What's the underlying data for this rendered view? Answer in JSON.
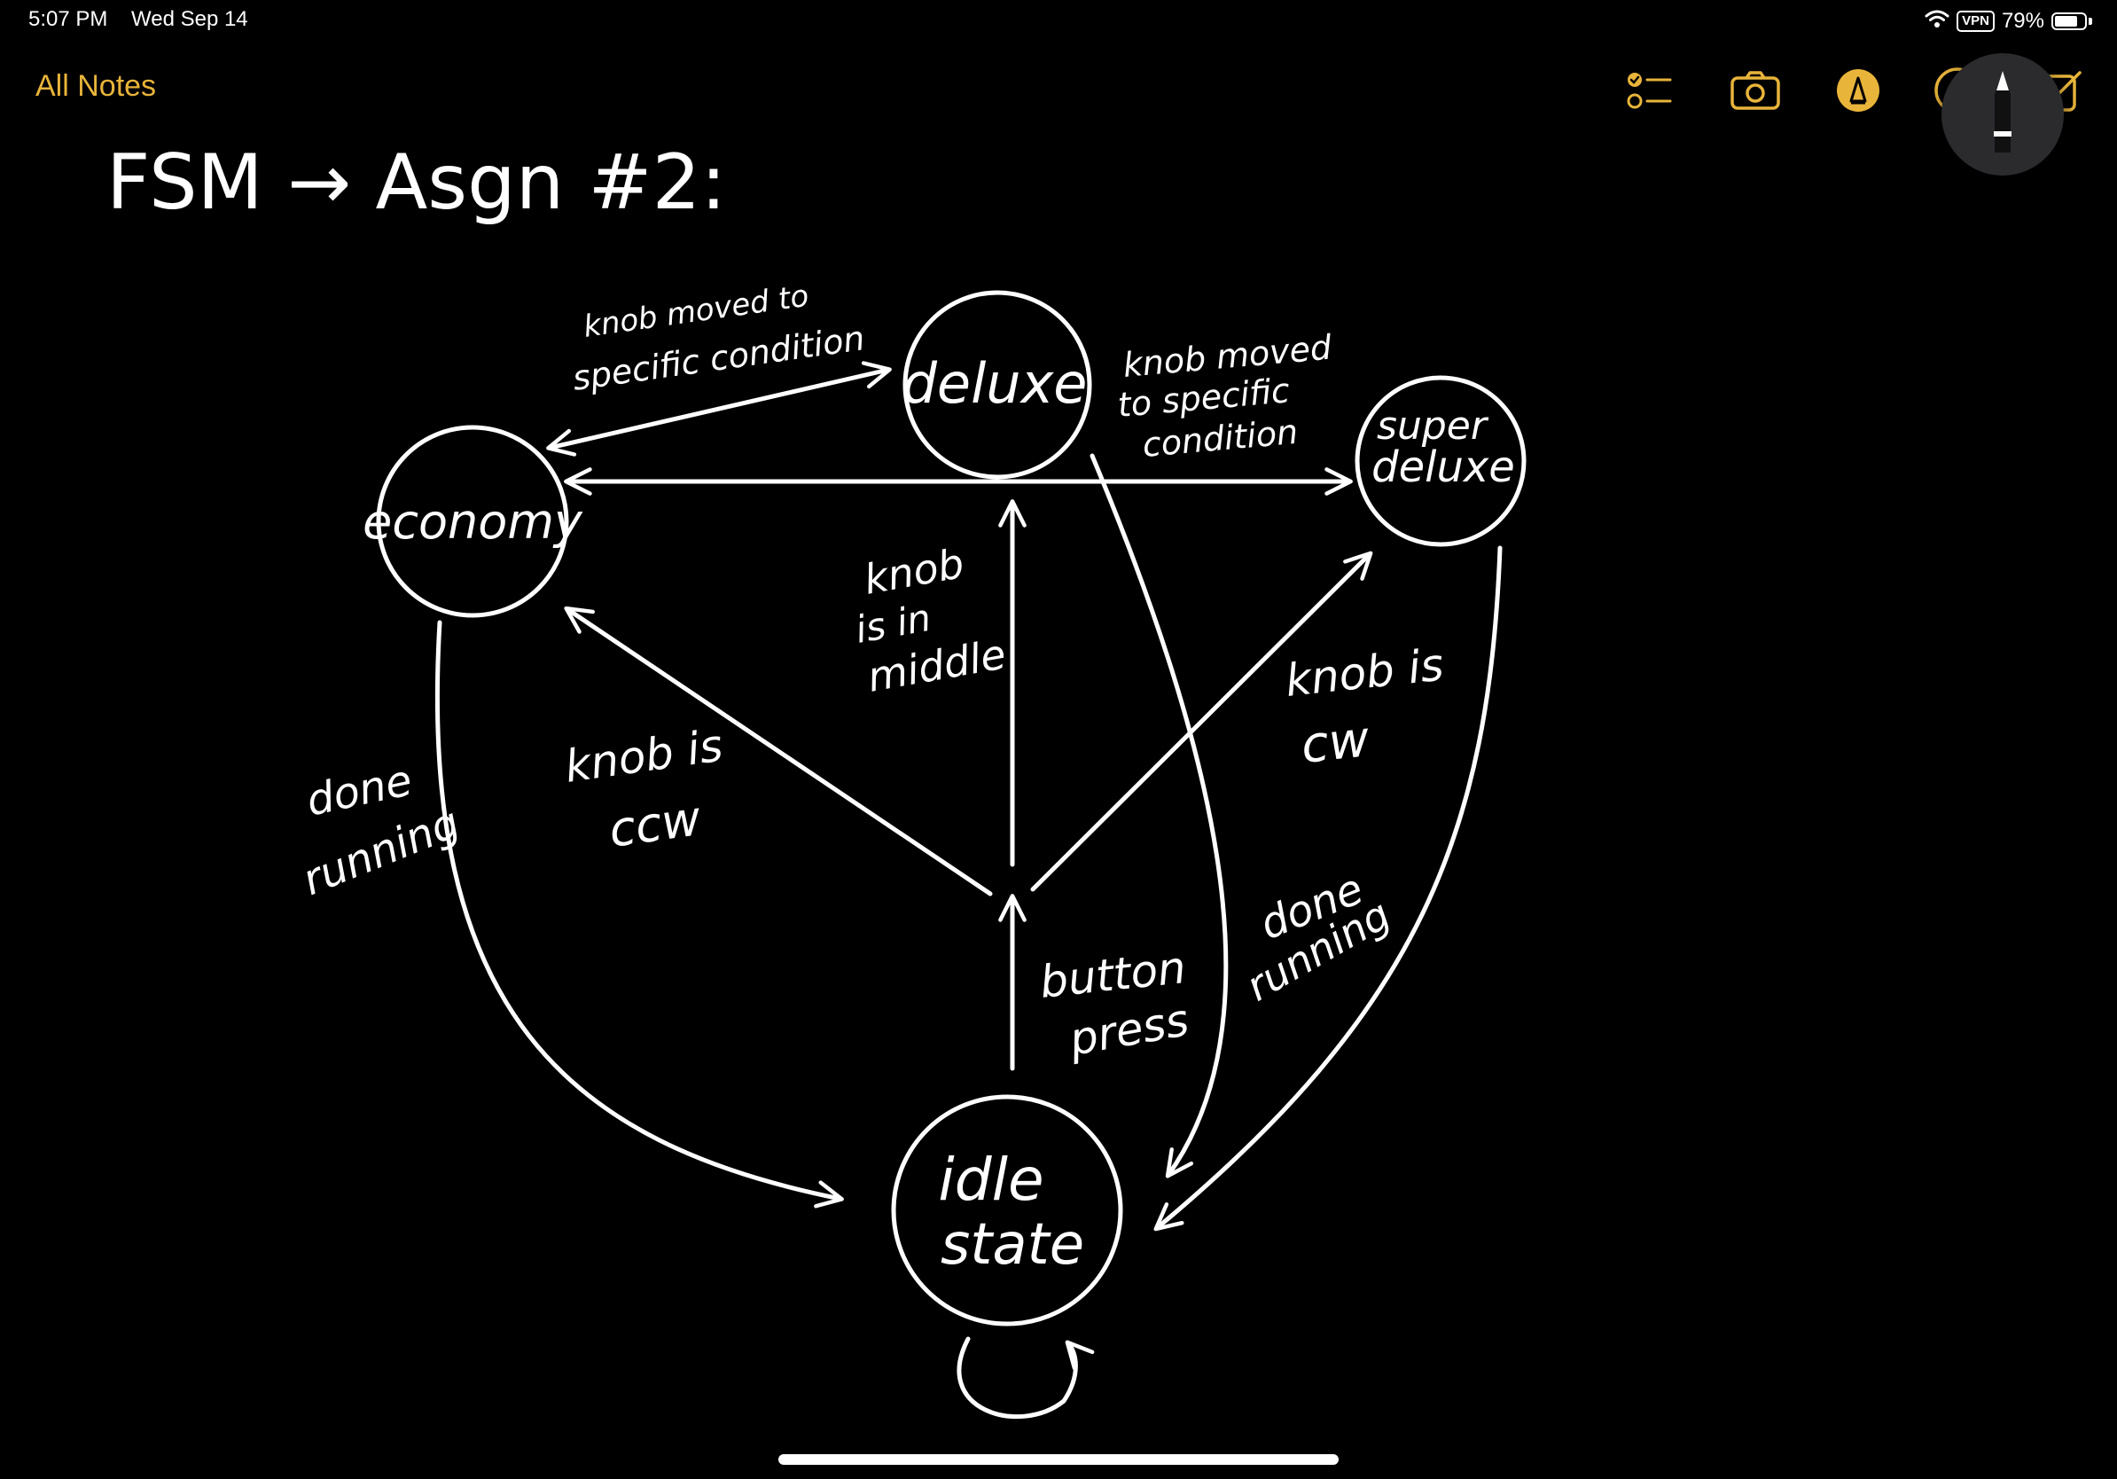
{
  "status_bar": {
    "time": "5:07 PM",
    "date": "Wed Sep 14",
    "vpn": "VPN",
    "battery": "79%",
    "battery_level": 0.79
  },
  "toolbar": {
    "back_label": "All Notes",
    "accent_color": "#e8b43a",
    "tools": [
      "checklist-icon",
      "camera-icon",
      "markup-icon",
      "more-icon",
      "compose-icon"
    ]
  },
  "note": {
    "title": "FSM → Asgn #2:",
    "states": {
      "economy": "economy",
      "deluxe": "deluxe",
      "super_deluxe": [
        "super",
        "deluxe"
      ],
      "idle": [
        "idle",
        "state"
      ]
    },
    "labels": {
      "econ_to_deluxe": [
        "knob moved to",
        "specific condition"
      ],
      "deluxe_to_super": [
        "knob moved",
        "to specific",
        "condition"
      ],
      "knob_middle": [
        "knob",
        "is in",
        "middle"
      ],
      "knob_ccw": [
        "knob is",
        "ccw"
      ],
      "knob_cw": [
        "knob is",
        "cw"
      ],
      "done_left": [
        "done",
        "running"
      ],
      "done_right": [
        "done",
        "running"
      ],
      "button_press": [
        "button",
        "press"
      ]
    }
  }
}
